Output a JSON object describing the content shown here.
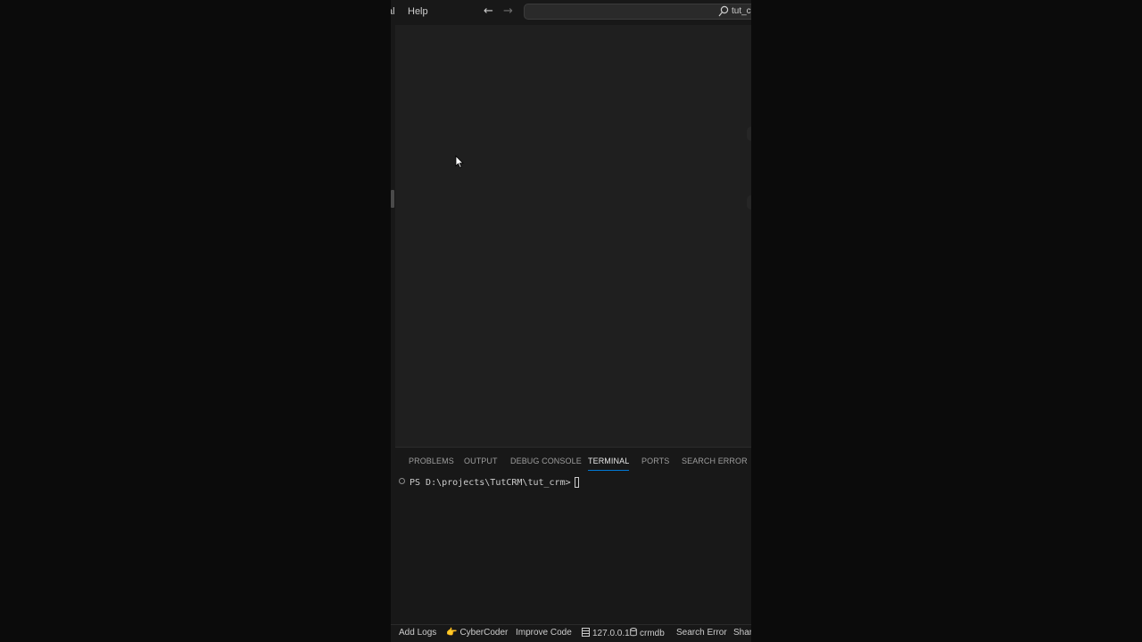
{
  "titlebar": {
    "menu_terminal": "al",
    "menu_help": "Help",
    "back_icon": "←",
    "forward_icon": "→",
    "command_center_text": "tut_cr"
  },
  "panel": {
    "tabs": [
      {
        "label": "PROBLEMS",
        "active": false
      },
      {
        "label": "OUTPUT",
        "active": false
      },
      {
        "label": "DEBUG CONSOLE",
        "active": false
      },
      {
        "label": "TERMINAL",
        "active": true
      },
      {
        "label": "PORTS",
        "active": false
      },
      {
        "label": "SEARCH ERROR",
        "active": false
      }
    ],
    "terminal_prompt": "PS D:\\projects\\TutCRM\\tut_crm>"
  },
  "statusbar": {
    "add_logs": "Add Logs",
    "cybercoder_icon": "👉",
    "cybercoder": "CyberCoder",
    "improve_code": "Improve Code",
    "host": "127.0.0.1",
    "database": "crmdb",
    "search_error": "Search Error",
    "share": "Shar"
  },
  "colors": {
    "accent": "#0078d4",
    "editor_bg": "#1f1f1f",
    "chrome_bg": "#181818"
  }
}
